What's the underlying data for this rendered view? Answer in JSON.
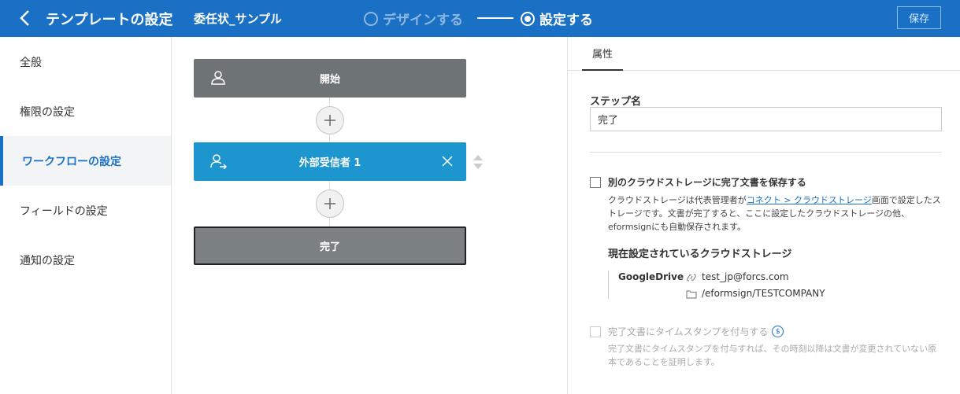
{
  "header": {
    "title": "テンプレートの設定",
    "doc_name": "委任状_サンプル",
    "step1": "デザインする",
    "step2": "設定する",
    "save": "保存",
    "color": "#1a70c4"
  },
  "sidebar": {
    "items": [
      {
        "label": "全般"
      },
      {
        "label": "権限の設定"
      },
      {
        "label": "ワークフローの設定"
      },
      {
        "label": "フィールドの設定"
      },
      {
        "label": "通知の設定"
      }
    ]
  },
  "workflow": {
    "start": "開始",
    "external": "外部受信者 1",
    "end": "完了"
  },
  "props": {
    "tab": "属性",
    "step_name_label": "ステップ名",
    "step_name_value": "完了",
    "cloud_save_label": "別のクラウドストレージに完了文書を保存する",
    "cloud_desc_pre": "クラウドストレージは代表管理者が",
    "cloud_desc_link": "コネクト > クラウドストレージ",
    "cloud_desc_post": "画面で設定したストレージです。文書が完了すると、ここに設定したクラウドストレージの他、eformsignにも自動保存されます。",
    "current_storage_title": "現在設定されているクラウドストレージ",
    "storage_name": "GoogleDrive",
    "storage_account": "test_jp@forcs.com",
    "storage_path": "/eformsign/TESTCOMPANY",
    "timestamp_label": "完了文書にタイムスタンプを付与する",
    "timestamp_desc": "完了文書にタイムスタンプを付与すれば、その時刻以降は文書が変更されていない原本であることを証明します。"
  }
}
